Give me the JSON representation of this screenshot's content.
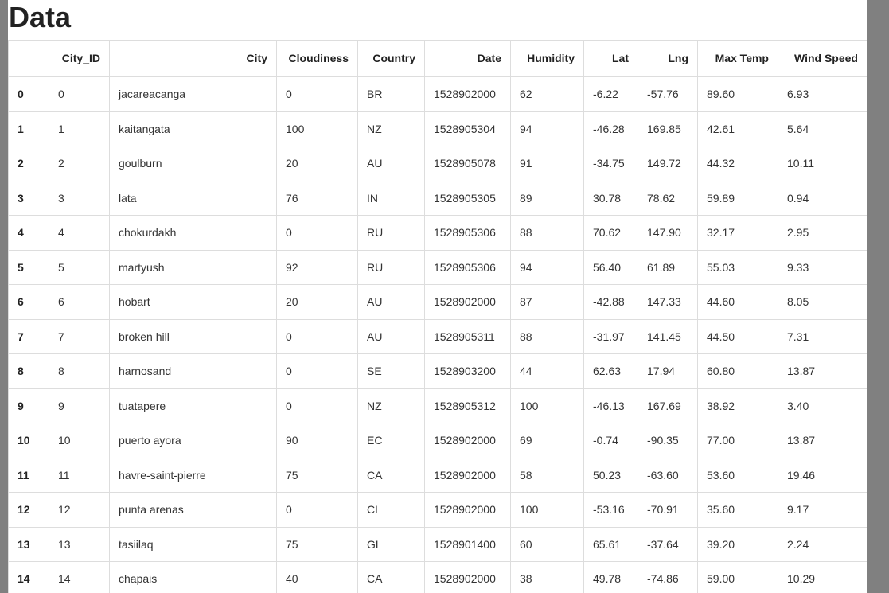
{
  "page": {
    "title": "Data"
  },
  "table": {
    "headers": [
      "",
      "City_ID",
      "City",
      "Cloudiness",
      "Country",
      "Date",
      "Humidity",
      "Lat",
      "Lng",
      "Max Temp",
      "Wind Speed"
    ],
    "rows": [
      [
        "0",
        "0",
        "jacareacanga",
        "0",
        "BR",
        "1528902000",
        "62",
        "-6.22",
        "-57.76",
        "89.60",
        "6.93"
      ],
      [
        "1",
        "1",
        "kaitangata",
        "100",
        "NZ",
        "1528905304",
        "94",
        "-46.28",
        "169.85",
        "42.61",
        "5.64"
      ],
      [
        "2",
        "2",
        "goulburn",
        "20",
        "AU",
        "1528905078",
        "91",
        "-34.75",
        "149.72",
        "44.32",
        "10.11"
      ],
      [
        "3",
        "3",
        "lata",
        "76",
        "IN",
        "1528905305",
        "89",
        "30.78",
        "78.62",
        "59.89",
        "0.94"
      ],
      [
        "4",
        "4",
        "chokurdakh",
        "0",
        "RU",
        "1528905306",
        "88",
        "70.62",
        "147.90",
        "32.17",
        "2.95"
      ],
      [
        "5",
        "5",
        "martyush",
        "92",
        "RU",
        "1528905306",
        "94",
        "56.40",
        "61.89",
        "55.03",
        "9.33"
      ],
      [
        "6",
        "6",
        "hobart",
        "20",
        "AU",
        "1528902000",
        "87",
        "-42.88",
        "147.33",
        "44.60",
        "8.05"
      ],
      [
        "7",
        "7",
        "broken hill",
        "0",
        "AU",
        "1528905311",
        "88",
        "-31.97",
        "141.45",
        "44.50",
        "7.31"
      ],
      [
        "8",
        "8",
        "harnosand",
        "0",
        "SE",
        "1528903200",
        "44",
        "62.63",
        "17.94",
        "60.80",
        "13.87"
      ],
      [
        "9",
        "9",
        "tuatapere",
        "0",
        "NZ",
        "1528905312",
        "100",
        "-46.13",
        "167.69",
        "38.92",
        "3.40"
      ],
      [
        "10",
        "10",
        "puerto ayora",
        "90",
        "EC",
        "1528902000",
        "69",
        "-0.74",
        "-90.35",
        "77.00",
        "13.87"
      ],
      [
        "11",
        "11",
        "havre-saint-pierre",
        "75",
        "CA",
        "1528902000",
        "58",
        "50.23",
        "-63.60",
        "53.60",
        "19.46"
      ],
      [
        "12",
        "12",
        "punta arenas",
        "0",
        "CL",
        "1528902000",
        "100",
        "-53.16",
        "-70.91",
        "35.60",
        "9.17"
      ],
      [
        "13",
        "13",
        "tasiilaq",
        "75",
        "GL",
        "1528901400",
        "60",
        "65.61",
        "-37.64",
        "39.20",
        "2.24"
      ],
      [
        "14",
        "14",
        "chapais",
        "40",
        "CA",
        "1528902000",
        "38",
        "49.78",
        "-74.86",
        "59.00",
        "10.29"
      ]
    ]
  }
}
